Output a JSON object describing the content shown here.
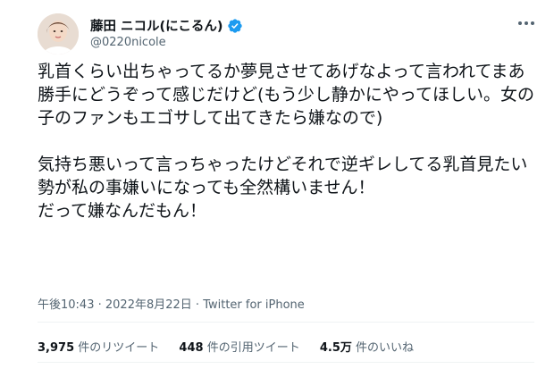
{
  "user": {
    "display_name": "藤田 ニコル(にこるん)",
    "handle": "@0220nicole",
    "verified_icon": "verified-badge-icon",
    "avatar_icon": "avatar-photo"
  },
  "tweet": {
    "paragraph1": "乳首くらい出ちゃってるか夢見させてあげなよって言われてまあ勝手にどうぞって感じだけど(もう少し静かにやってほしい。女の子のファンもエゴサして出てきたら嫌なので)",
    "paragraph2": "気持ち悪いって言っちゃったけどそれで逆ギレしてる乳首見たい勢が私の事嫌いになっても全然構いません！\nだって嫌なんだもん！"
  },
  "meta": {
    "time": "午後10:43",
    "sep": " · ",
    "date": "2022年8月22日",
    "app": "Twitter for iPhone"
  },
  "stats": {
    "retweets_count": "3,975",
    "retweets_label": "件のリツイート",
    "quotes_count": "448",
    "quotes_label": "件の引用ツイート",
    "likes_count": "4.5万",
    "likes_label": "件のいいね"
  },
  "colors": {
    "verified": "#1d9bf0",
    "secondary_text": "#536471",
    "primary_text": "#0f1419"
  }
}
